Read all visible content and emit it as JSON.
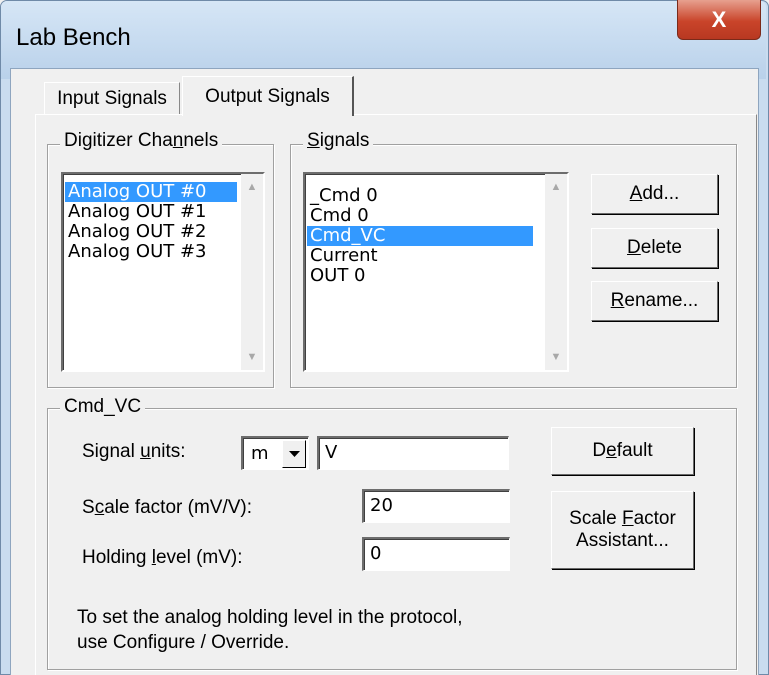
{
  "window": {
    "title": "Lab Bench",
    "close_glyph": "X"
  },
  "tabs": [
    {
      "label": "Input Signals",
      "active": false
    },
    {
      "label": "Output Signals",
      "active": true
    }
  ],
  "digitizer": {
    "label_pre": "Digitizer Cha",
    "label_ul": "n",
    "label_post": "nels",
    "items": [
      "Analog OUT #0",
      "Analog OUT #1",
      "Analog OUT #2",
      "Analog OUT #3"
    ],
    "selected_index": 0
  },
  "signals": {
    "label_ul": "S",
    "label_post": "ignals",
    "items": [
      "_Cmd 0",
      "Cmd 0",
      "Cmd_VC",
      "Current",
      "OUT 0"
    ],
    "selected_index": 2
  },
  "buttons": {
    "add": {
      "ul": "A",
      "post": "dd..."
    },
    "delete": {
      "ul": "D",
      "post": "elete"
    },
    "rename": {
      "ul": "R",
      "post": "ename..."
    },
    "default": {
      "pre": "D",
      "ul": "e",
      "post": "fault"
    },
    "scale_factor": {
      "line1_pre": "Scale ",
      "line1_ul": "F",
      "line1_post": "actor",
      "line2": "Assistant..."
    }
  },
  "signal_group": {
    "label": "Cmd_VC",
    "units_label_pre": "Signal ",
    "units_label_ul": "u",
    "units_label_post": "nits:",
    "units_prefix": "m",
    "units_value": "V",
    "scale_label_pre": "S",
    "scale_label_ul": "c",
    "scale_label_post": "ale factor (mV/V):",
    "scale_value": "20",
    "holding_label_pre": "Holding ",
    "holding_label_ul": "l",
    "holding_label_post": "evel (mV):",
    "holding_value": "0",
    "note_line1": "To set the analog holding level in the protocol,",
    "note_line2": "use Configure / Override."
  },
  "icons": {
    "scroll_up": "up-triangle",
    "scroll_down": "down-triangle",
    "combo_dropdown": "down-triangle"
  }
}
